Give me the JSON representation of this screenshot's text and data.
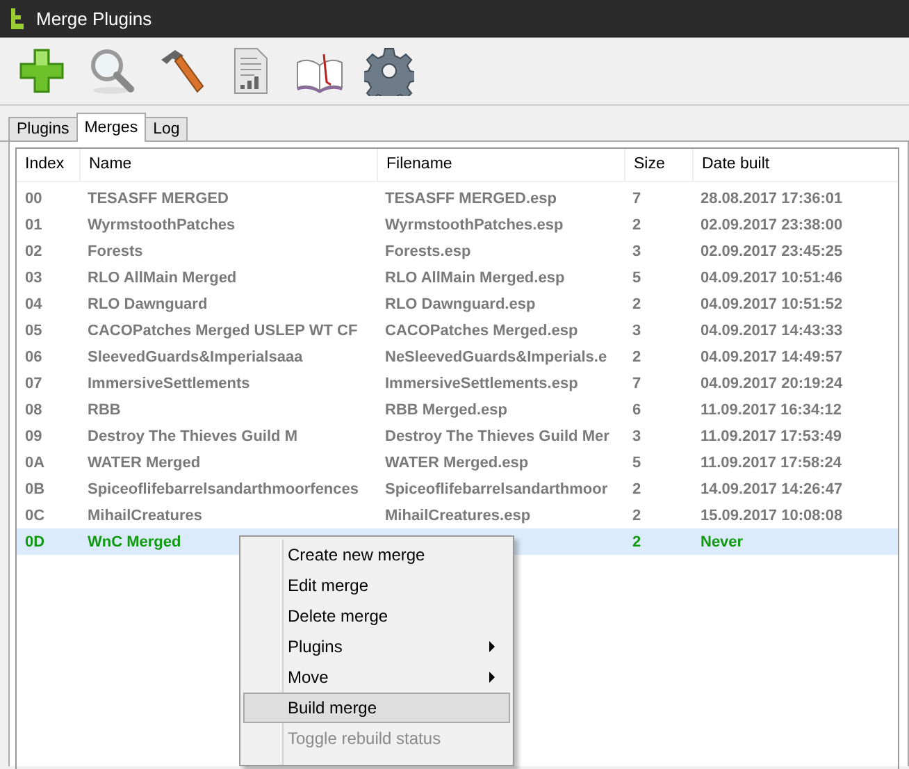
{
  "window": {
    "title": "Merge Plugins"
  },
  "toolbar": [
    {
      "kind": "add"
    },
    {
      "kind": "search"
    },
    {
      "kind": "build"
    },
    {
      "kind": "report"
    },
    {
      "kind": "help"
    },
    {
      "kind": "settings"
    }
  ],
  "tabs": [
    {
      "label": "Plugins",
      "selected": false
    },
    {
      "label": "Merges",
      "selected": true
    },
    {
      "label": "Log",
      "selected": false
    }
  ],
  "table": {
    "columns": [
      "Index",
      "Name",
      "Filename",
      "Size",
      "Date built"
    ],
    "rows": [
      {
        "index": "00",
        "name": "TESASFF MERGED",
        "filename": "TESASFF MERGED.esp",
        "size": "7",
        "date": "28.08.2017 17:36:01",
        "color": "#7a7a7a",
        "selected": false
      },
      {
        "index": "01",
        "name": "WyrmstoothPatches",
        "filename": "WyrmstoothPatches.esp",
        "size": "2",
        "date": "02.09.2017 23:38:00",
        "color": "#7a7a7a",
        "selected": false
      },
      {
        "index": "02",
        "name": "Forests",
        "filename": "Forests.esp",
        "size": "3",
        "date": "02.09.2017 23:45:25",
        "color": "#7a7a7a",
        "selected": false
      },
      {
        "index": "03",
        "name": "RLO AllMain Merged",
        "filename": "RLO AllMain Merged.esp",
        "size": "5",
        "date": "04.09.2017 10:51:46",
        "color": "#7a7a7a",
        "selected": false
      },
      {
        "index": "04",
        "name": "RLO Dawnguard",
        "filename": "RLO Dawnguard.esp",
        "size": "2",
        "date": "04.09.2017 10:51:52",
        "color": "#7a7a7a",
        "selected": false
      },
      {
        "index": "05",
        "name": "CACOPatches Merged USLEP WT CF",
        "filename": "CACOPatches Merged.esp",
        "size": "3",
        "date": "04.09.2017 14:43:33",
        "color": "#7a7a7a",
        "selected": false
      },
      {
        "index": "06",
        "name": "SleevedGuards&Imperialsaaa",
        "filename": "NeSleevedGuards&Imperials.e",
        "size": "2",
        "date": "04.09.2017 14:49:57",
        "color": "#7a7a7a",
        "selected": false
      },
      {
        "index": "07",
        "name": "ImmersiveSettlements",
        "filename": "ImmersiveSettlements.esp",
        "size": "7",
        "date": "04.09.2017 20:19:24",
        "color": "#7a7a7a",
        "selected": false
      },
      {
        "index": "08",
        "name": "RBB",
        "filename": "RBB Merged.esp",
        "size": "6",
        "date": "11.09.2017 16:34:12",
        "color": "#7a7a7a",
        "selected": false
      },
      {
        "index": "09",
        "name": "Destroy The Thieves Guild M",
        "filename": "Destroy The Thieves Guild Mer",
        "size": "3",
        "date": "11.09.2017 17:53:49",
        "color": "#7a7a7a",
        "selected": false
      },
      {
        "index": "0A",
        "name": "WATER Merged",
        "filename": "WATER Merged.esp",
        "size": "5",
        "date": "11.09.2017 17:58:24",
        "color": "#7a7a7a",
        "selected": false
      },
      {
        "index": "0B",
        "name": "Spiceoflifebarrelsandarthmoorfences",
        "filename": "Spiceoflifebarrelsandarthmoor",
        "size": "2",
        "date": "14.09.2017 14:26:47",
        "color": "#7a7a7a",
        "selected": false
      },
      {
        "index": "0C",
        "name": "MihailCreatures",
        "filename": "MihailCreatures.esp",
        "size": "2",
        "date": "15.09.2017 10:08:08",
        "color": "#7a7a7a",
        "selected": false
      },
      {
        "index": "0D",
        "name": "WnC Merged",
        "size": "2",
        "date": "Never",
        "color": "#119911",
        "selected": true
      }
    ]
  },
  "context_menu": {
    "items": [
      {
        "label": "Create new merge",
        "submenu": false,
        "disabled": false,
        "selected": false
      },
      {
        "label": "Edit merge",
        "submenu": false,
        "disabled": false,
        "selected": false
      },
      {
        "label": "Delete merge",
        "submenu": false,
        "disabled": false,
        "selected": false
      },
      {
        "label": "Plugins",
        "submenu": true,
        "disabled": false,
        "selected": false
      },
      {
        "label": "Move",
        "submenu": true,
        "disabled": false,
        "selected": false
      },
      {
        "label": "Build merge",
        "submenu": false,
        "disabled": false,
        "selected": true
      },
      {
        "label": "Toggle rebuild status",
        "submenu": false,
        "disabled": true,
        "selected": false
      }
    ]
  }
}
